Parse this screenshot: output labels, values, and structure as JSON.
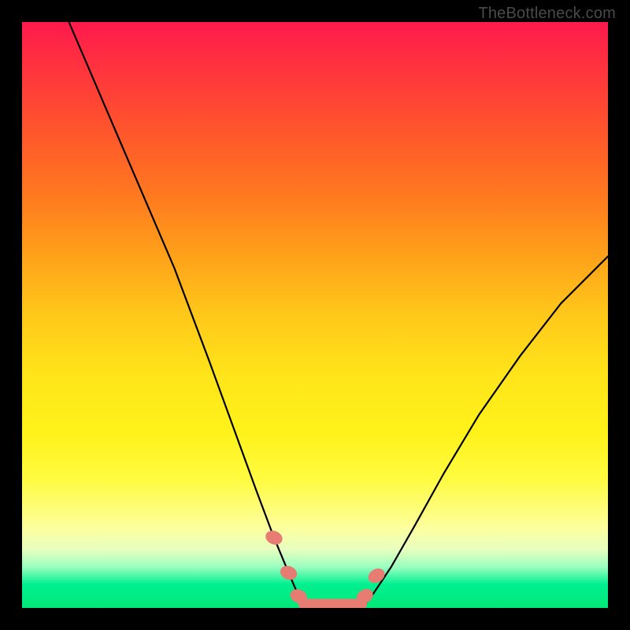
{
  "attribution": "TheBottleneck.com",
  "colors": {
    "frame": "#000000",
    "curve": "#000000",
    "marker": "#e77c72",
    "flat_segment": "#e77c72"
  },
  "chart_data": {
    "type": "line",
    "title": "",
    "xlabel": "",
    "ylabel": "",
    "xlim": [
      0,
      100
    ],
    "ylim": [
      0,
      100
    ],
    "series": [
      {
        "name": "left-curve",
        "x": [
          8,
          14,
          20,
          26,
          32,
          36,
          40,
          43,
          45.5,
          47,
          48
        ],
        "y": [
          100,
          86,
          72,
          58,
          42,
          31,
          20,
          12,
          6,
          2.5,
          0
        ]
      },
      {
        "name": "flat-bottom",
        "x": [
          48,
          58
        ],
        "y": [
          0,
          0
        ]
      },
      {
        "name": "right-curve",
        "x": [
          58,
          60,
          63,
          67,
          72,
          78,
          85,
          92,
          100
        ],
        "y": [
          0,
          2.5,
          7,
          14,
          23,
          33,
          43,
          52,
          60
        ]
      }
    ],
    "markers": [
      {
        "x": 43.0,
        "y": 12.0
      },
      {
        "x": 45.5,
        "y": 6.0
      },
      {
        "x": 47.2,
        "y": 2.0
      },
      {
        "x": 58.5,
        "y": 2.0
      },
      {
        "x": 60.5,
        "y": 5.5
      }
    ],
    "flat_segment": {
      "x0": 48,
      "x1": 58,
      "y": 0
    }
  }
}
